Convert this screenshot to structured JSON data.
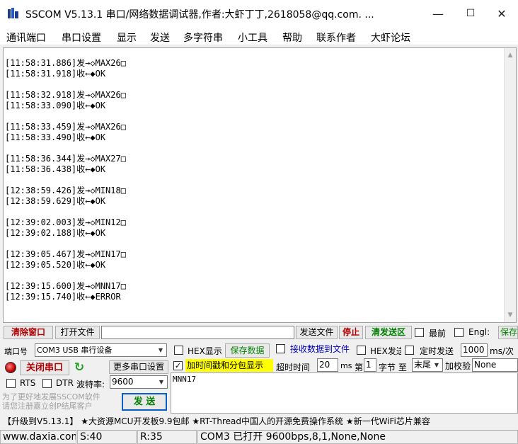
{
  "window": {
    "title": "SSCOM V5.13.1 串口/网络数据调试器,作者:大虾丁丁,2618058@qq.com. ...",
    "minimize": "—",
    "maximize": "☐",
    "close": "✕"
  },
  "menu": [
    "通讯端口",
    "串口设置",
    "显示",
    "发送",
    "多字符串",
    "小工具",
    "帮助",
    "联系作者",
    "大虾论坛"
  ],
  "receive": {
    "lines": [
      "[11:58:31.886]发→◇MAX26□",
      "[11:58:31.918]收←◆OK",
      "",
      "[11:58:32.918]发→◇MAX26□",
      "[11:58:33.090]收←◆OK",
      "",
      "[11:58:33.459]发→◇MAX26□",
      "[11:58:33.490]收←◆OK",
      "",
      "[11:58:36.344]发→◇MAX27□",
      "[11:58:36.438]收←◆OK",
      "",
      "[12:38:59.426]发→◇MIN18□",
      "[12:38:59.629]收←◆OK",
      "",
      "[12:39:02.003]发→◇MIN12□",
      "[12:39:02.188]收←◆OK",
      "",
      "[12:39:05.467]发→◇MIN17□",
      "[12:39:05.520]收←◆OK",
      "",
      "[12:39:15.600]发→◇MNN17□",
      "[12:39:15.740]收←◆ERROR"
    ]
  },
  "row1": {
    "clear": "清除窗口",
    "open_file": "打开文件",
    "send_file": "发送文件",
    "stop": "停止",
    "clear_send": "清发送区",
    "topmost": "最前",
    "english": "Engl:",
    "save": "保存"
  },
  "row2": {
    "port_label": "端口号",
    "port_value": "COM3 USB 串行设备",
    "hex_display": "HEX显示",
    "save_data": "保存数据",
    "recv_to_file": "接收数据到文件",
    "hex_send": "HEX发送",
    "timed_send": "定时发送",
    "interval_value": "1000",
    "interval_unit": "ms/次"
  },
  "row3": {
    "close_port": "关闭串口",
    "more_settings": "更多串口设置",
    "timestamp": "加时间戳和分包显示",
    "timeout_label": "超时时间",
    "timeout_value": "20",
    "timeout_unit": "ms",
    "nth_label": "第",
    "nth_value": "1",
    "byte_label": "字节 至",
    "end_value": "末尾",
    "checksum_label": "加校验",
    "checksum_value": "None"
  },
  "row4": {
    "rts": "RTS",
    "dtr": "DTR",
    "baud_label": "波特率:",
    "baud_value": "9600"
  },
  "promo": "为了更好地发展SSCOM软件\n请您注册嘉立创P结尾客户",
  "send": {
    "button": "发 送",
    "text": "MNN17"
  },
  "notice": "【升级到V5.13.1】 ★大资源MCU开发板9.9包邮  ★RT-Thread中国人的开源免费操作系统  ★新一代WiFi芯片兼容",
  "status": {
    "site": "www.daxia.com",
    "sent": "S:40",
    "received": "R:35",
    "port_state": "COM3 已打开  9600bps,8,1,None,None"
  },
  "colors": {
    "green_button_text": "#008000",
    "red_button_text": "#b00000",
    "highlight_yellow": "#ffff00"
  }
}
